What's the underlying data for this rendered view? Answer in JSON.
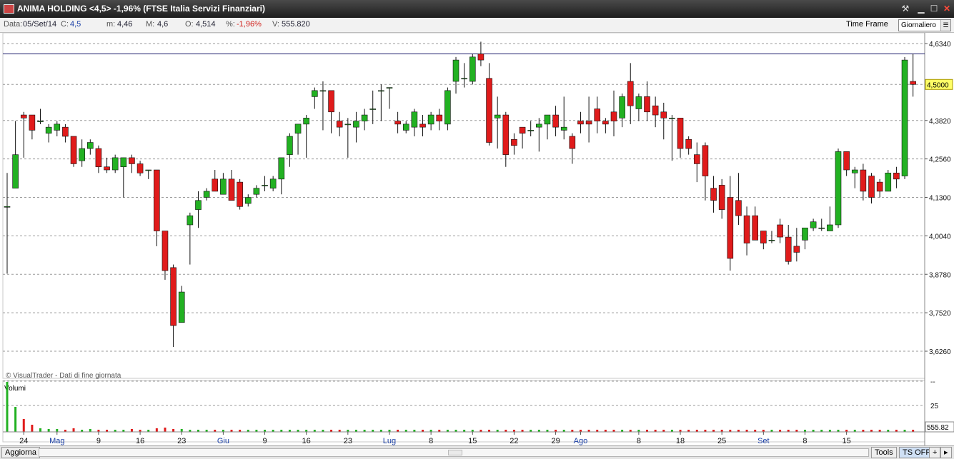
{
  "window": {
    "title": "ANIMA HOLDING <4,5> -1,96%  (FTSE Italia Servizi Finanziari)",
    "icons": [
      "tools-icon",
      "minimize-icon",
      "maximize-icon",
      "close-icon"
    ]
  },
  "infobar": {
    "date_label": "Data:",
    "date": "05/Set/14",
    "close_label": "C:",
    "close": "4,5",
    "min_label": "m:",
    "min": "4,46",
    "max_label": "M:",
    "max": "4,6",
    "open_label": "O:",
    "open": "4,514",
    "pct_label": "%:",
    "pct": "-1,96%",
    "vol_label": "V:",
    "vol": "555.820",
    "timeframe_label": "Time Frame",
    "timeframe_value": "Giornaliero"
  },
  "colors": {
    "up": "#22b122",
    "down": "#e01b1b",
    "grid": "#9a9a9a",
    "hline": "#1a1a6a",
    "last_price_bg": "#ffff66"
  },
  "footer": {
    "refresh_button": "Aggiorna",
    "tools_button": "Tools",
    "ts_button": "TS OFF",
    "plus_button": "+",
    "arrow_icon": "chevron-right-icon"
  },
  "chart_data": {
    "type": "candlestick",
    "copyright": "© VisualTrader - Dati di fine giornata",
    "price_axis": {
      "ticks": [
        "4,6340",
        "4,5000",
        "4,3820",
        "4,2560",
        "4,1300",
        "4,0040",
        "3,8780",
        "3,7520",
        "3,6260"
      ],
      "last_price_label": "4,5000",
      "horizontal_line": 4.6
    },
    "x_ticks": [
      {
        "label": "24",
        "bar": 2,
        "month": false
      },
      {
        "label": "Mag",
        "bar": 6,
        "month": true
      },
      {
        "label": "9",
        "bar": 11,
        "month": false
      },
      {
        "label": "16",
        "bar": 16,
        "month": false
      },
      {
        "label": "23",
        "bar": 21,
        "month": false
      },
      {
        "label": "Giu",
        "bar": 26,
        "month": true
      },
      {
        "label": "9",
        "bar": 31,
        "month": false
      },
      {
        "label": "16",
        "bar": 36,
        "month": false
      },
      {
        "label": "23",
        "bar": 41,
        "month": false
      },
      {
        "label": "Lug",
        "bar": 46,
        "month": true
      },
      {
        "label": "8",
        "bar": 51,
        "month": false
      },
      {
        "label": "15",
        "bar": 56,
        "month": false
      },
      {
        "label": "22",
        "bar": 61,
        "month": false
      },
      {
        "label": "29",
        "bar": 66,
        "month": false
      },
      {
        "label": "Ago",
        "bar": 69,
        "month": true
      },
      {
        "label": "8",
        "bar": 76,
        "month": false
      },
      {
        "label": "18",
        "bar": 81,
        "month": false
      },
      {
        "label": "25",
        "bar": 86,
        "month": false
      },
      {
        "label": "Set",
        "bar": 91,
        "month": true
      },
      {
        "label": "8",
        "bar": 96,
        "month": false
      },
      {
        "label": "15",
        "bar": 101,
        "month": false
      }
    ],
    "volume_panel": {
      "title": "Volumi",
      "ticks": [
        "--",
        "25"
      ],
      "last_volume_label": "555.82"
    },
    "candles": [
      [
        4.1,
        4.1,
        4.21,
        3.88
      ],
      [
        4.16,
        4.27,
        4.38,
        4.16
      ],
      [
        4.4,
        4.39,
        4.41,
        4.26
      ],
      [
        4.4,
        4.35,
        4.4,
        4.32
      ],
      [
        4.38,
        4.38,
        4.42,
        4.37
      ],
      [
        4.34,
        4.36,
        4.37,
        4.31
      ],
      [
        4.35,
        4.37,
        4.38,
        4.33
      ],
      [
        4.36,
        4.33,
        4.37,
        4.31
      ],
      [
        4.33,
        4.24,
        4.33,
        4.23
      ],
      [
        4.25,
        4.29,
        4.32,
        4.23
      ],
      [
        4.29,
        4.31,
        4.32,
        4.27
      ],
      [
        4.29,
        4.23,
        4.3,
        4.21
      ],
      [
        4.23,
        4.22,
        4.26,
        4.21
      ],
      [
        4.22,
        4.26,
        4.27,
        4.21
      ],
      [
        4.23,
        4.26,
        4.26,
        4.13
      ],
      [
        4.26,
        4.24,
        4.27,
        4.21
      ],
      [
        4.24,
        4.21,
        4.25,
        4.2
      ],
      [
        4.22,
        4.22,
        4.22,
        4.19
      ],
      [
        4.22,
        4.02,
        4.22,
        3.97
      ],
      [
        4.02,
        3.89,
        4.0,
        3.86
      ],
      [
        3.9,
        3.71,
        3.91,
        3.64
      ],
      [
        3.72,
        3.82,
        3.84,
        3.72
      ],
      [
        4.04,
        4.07,
        4.08,
        3.91
      ],
      [
        4.09,
        4.12,
        4.15,
        4.03
      ],
      [
        4.13,
        4.15,
        4.16,
        4.12
      ],
      [
        4.19,
        4.15,
        4.22,
        4.15
      ],
      [
        4.14,
        4.19,
        4.21,
        4.14
      ],
      [
        4.19,
        4.12,
        4.22,
        4.12
      ],
      [
        4.18,
        4.1,
        4.19,
        4.09
      ],
      [
        4.11,
        4.13,
        4.14,
        4.1
      ],
      [
        4.14,
        4.16,
        4.17,
        4.13
      ],
      [
        4.17,
        4.17,
        4.2,
        4.15
      ],
      [
        4.16,
        4.19,
        4.2,
        4.15
      ],
      [
        4.19,
        4.26,
        4.26,
        4.14
      ],
      [
        4.27,
        4.33,
        4.34,
        4.23
      ],
      [
        4.34,
        4.37,
        4.37,
        4.27
      ],
      [
        4.37,
        4.39,
        4.4,
        4.26
      ],
      [
        4.46,
        4.48,
        4.49,
        4.42
      ],
      [
        4.48,
        4.48,
        4.51,
        4.35
      ],
      [
        4.48,
        4.41,
        4.47,
        4.34
      ],
      [
        4.38,
        4.36,
        4.41,
        4.33
      ],
      [
        4.37,
        4.37,
        4.39,
        4.26
      ],
      [
        4.36,
        4.38,
        4.41,
        4.31
      ],
      [
        4.38,
        4.4,
        4.42,
        4.35
      ],
      [
        4.42,
        4.42,
        4.48,
        4.37
      ],
      [
        4.48,
        4.48,
        4.5,
        4.38
      ],
      [
        4.49,
        4.49,
        4.49,
        4.42
      ],
      [
        4.38,
        4.37,
        4.41,
        4.34
      ],
      [
        4.35,
        4.37,
        4.38,
        4.34
      ],
      [
        4.36,
        4.41,
        4.42,
        4.33
      ],
      [
        4.37,
        4.36,
        4.4,
        4.33
      ],
      [
        4.37,
        4.4,
        4.41,
        4.35
      ],
      [
        4.4,
        4.38,
        4.42,
        4.35
      ],
      [
        4.37,
        4.48,
        4.49,
        4.35
      ],
      [
        4.51,
        4.58,
        4.59,
        4.47
      ],
      [
        4.52,
        4.52,
        4.57,
        4.49
      ],
      [
        4.51,
        4.59,
        4.6,
        4.5
      ],
      [
        4.6,
        4.58,
        4.64,
        4.56
      ],
      [
        4.52,
        4.31,
        4.57,
        4.3
      ],
      [
        4.39,
        4.4,
        4.46,
        4.29
      ],
      [
        4.4,
        4.27,
        4.41,
        4.23
      ],
      [
        4.32,
        4.3,
        4.34,
        4.27
      ],
      [
        4.36,
        4.34,
        4.36,
        4.29
      ],
      [
        4.35,
        4.35,
        4.38,
        4.33
      ],
      [
        4.36,
        4.37,
        4.39,
        4.28
      ],
      [
        4.37,
        4.4,
        4.4,
        4.32
      ],
      [
        4.4,
        4.36,
        4.43,
        4.33
      ],
      [
        4.35,
        4.36,
        4.46,
        4.32
      ],
      [
        4.33,
        4.29,
        4.34,
        4.24
      ],
      [
        4.38,
        4.37,
        4.41,
        4.34
      ],
      [
        4.38,
        4.37,
        4.46,
        4.31
      ],
      [
        4.42,
        4.38,
        4.46,
        4.34
      ],
      [
        4.38,
        4.37,
        4.39,
        4.34
      ],
      [
        4.41,
        4.38,
        4.48,
        4.33
      ],
      [
        4.39,
        4.46,
        4.47,
        4.36
      ],
      [
        4.51,
        4.43,
        4.57,
        4.37
      ],
      [
        4.42,
        4.46,
        4.47,
        4.38
      ],
      [
        4.46,
        4.41,
        4.51,
        4.38
      ],
      [
        4.43,
        4.4,
        4.46,
        4.36
      ],
      [
        4.41,
        4.39,
        4.44,
        4.32
      ],
      [
        4.39,
        4.39,
        4.4,
        4.25
      ],
      [
        4.39,
        4.29,
        4.39,
        4.26
      ],
      [
        4.32,
        4.29,
        4.33,
        4.27
      ],
      [
        4.27,
        4.24,
        4.31,
        4.18
      ],
      [
        4.3,
        4.2,
        4.31,
        4.12
      ],
      [
        4.16,
        4.12,
        4.2,
        4.08
      ],
      [
        4.17,
        4.09,
        4.19,
        4.06
      ],
      [
        4.13,
        3.93,
        4.2,
        3.89
      ],
      [
        4.12,
        4.07,
        4.21,
        4.04
      ],
      [
        4.07,
        3.98,
        4.1,
        3.94
      ],
      [
        4.07,
        3.99,
        4.1,
        4.01
      ],
      [
        4.02,
        3.98,
        4.01,
        3.96
      ],
      [
        3.99,
        3.99,
        4.02,
        3.98
      ],
      [
        4.04,
        4.0,
        4.06,
        3.98
      ],
      [
        4.0,
        3.92,
        4.04,
        3.91
      ],
      [
        3.97,
        3.95,
        4.03,
        3.92
      ],
      [
        3.99,
        4.03,
        4.03,
        3.96
      ],
      [
        4.03,
        4.05,
        4.06,
        4.02
      ],
      [
        4.03,
        4.03,
        4.06,
        4.02
      ],
      [
        4.02,
        4.04,
        4.1,
        4.02
      ],
      [
        4.04,
        4.28,
        4.29,
        4.03
      ],
      [
        4.28,
        4.22,
        4.28,
        4.2
      ],
      [
        4.21,
        4.22,
        4.23,
        4.16
      ],
      [
        4.22,
        4.15,
        4.24,
        4.12
      ],
      [
        4.2,
        4.13,
        4.21,
        4.11
      ],
      [
        4.18,
        4.15,
        4.19,
        4.13
      ],
      [
        4.15,
        4.21,
        4.22,
        4.15
      ],
      [
        4.21,
        4.19,
        4.23,
        4.16
      ],
      [
        4.2,
        4.58,
        4.59,
        4.19
      ],
      [
        4.51,
        4.5,
        4.6,
        4.46
      ]
    ],
    "volumes": [
      70,
      35,
      18,
      10,
      5,
      4,
      4,
      3,
      5,
      3,
      4,
      3,
      3,
      3,
      3,
      4,
      3,
      3,
      5,
      6,
      4,
      4,
      3,
      3,
      3,
      3,
      3,
      3,
      3,
      3,
      3,
      3,
      3,
      3,
      3,
      3,
      3,
      3,
      3,
      3,
      3,
      3,
      3,
      3,
      3,
      3,
      3,
      3,
      3,
      3,
      3,
      3,
      3,
      3,
      3,
      3,
      3,
      3,
      3,
      3,
      3,
      3,
      3,
      3,
      3,
      3,
      3,
      3,
      3,
      3,
      3,
      3,
      3,
      3,
      3,
      3,
      3,
      3,
      3,
      3,
      3,
      3,
      3,
      3,
      3,
      3,
      3,
      3,
      3,
      3,
      3,
      3,
      3,
      3,
      3,
      3,
      3,
      3,
      3,
      3,
      3,
      3,
      3,
      3,
      3,
      3,
      3,
      3,
      3,
      3
    ]
  }
}
